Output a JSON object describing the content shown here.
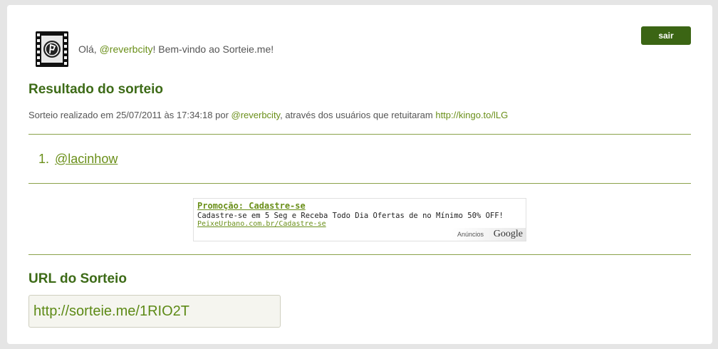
{
  "header": {
    "greeting_prefix": "Olá, ",
    "username": "@reverbcity",
    "greeting_suffix": "! Bem-vindo ao Sorteie.me!",
    "logout_label": "sair"
  },
  "result": {
    "title": "Resultado do sorteio",
    "meta_prefix": "Sorteio realizado em 25/07/2011 às 17:34:18 por ",
    "meta_user": "@reverbcity",
    "meta_middle": ", através dos usuários que retuitaram ",
    "meta_link": "http://kingo.to/lLG",
    "winners": [
      {
        "number": "1.",
        "handle": "@lacinhow"
      }
    ]
  },
  "ad": {
    "title": "Promoção: Cadastre-se",
    "text": "Cadastre-se em 5 Seg e Receba Todo Dia Ofertas de no Mínimo 50% OFF!",
    "link": "PeixeUrbano.com.br/Cadastre-se",
    "badge_label": "Anúncios",
    "badge_brand": "Google"
  },
  "url_section": {
    "title": "URL do Sorteio",
    "value": "http://sorteie.me/1RIO2T"
  },
  "colors": {
    "accent_green": "#3d6b17",
    "link_green": "#6a8f19",
    "button_bg": "#3b6514"
  },
  "icons": {
    "avatar": "film-strip-logo-icon",
    "ad_brand": "google-logo"
  }
}
